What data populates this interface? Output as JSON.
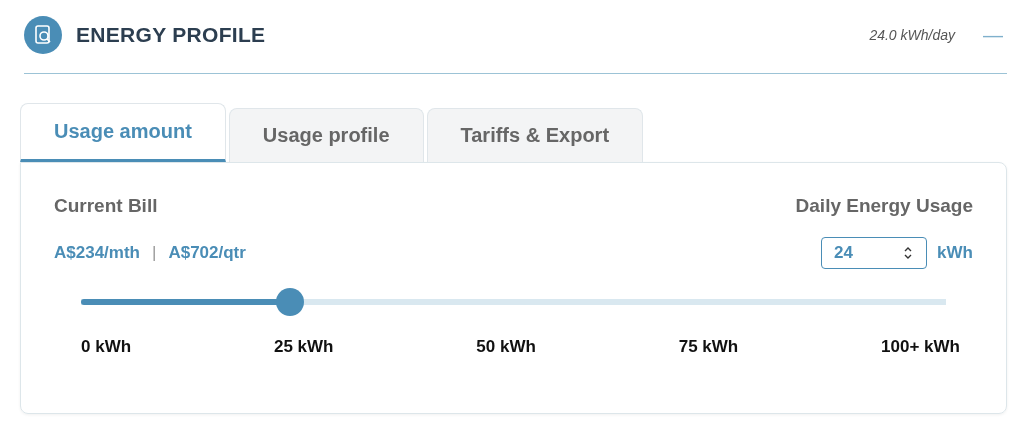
{
  "header": {
    "title": "ENERGY PROFILE",
    "summary": "24.0 kWh/day",
    "collapse_symbol": "—"
  },
  "tabs": [
    {
      "label": "Usage amount",
      "selected": true
    },
    {
      "label": "Usage profile",
      "selected": false
    },
    {
      "label": "Tariffs & Export",
      "selected": false
    }
  ],
  "bill": {
    "label": "Current Bill",
    "monthly": "A$234/mth",
    "separator": "|",
    "quarterly": "A$702/qtr"
  },
  "usage": {
    "label": "Daily Energy Usage",
    "value": "24",
    "unit": "kWh"
  },
  "slider": {
    "level": 0.242,
    "ticks": [
      "0 kWh",
      "25 kWh",
      "50 kWh",
      "75 kWh",
      "100+ kWh"
    ]
  }
}
